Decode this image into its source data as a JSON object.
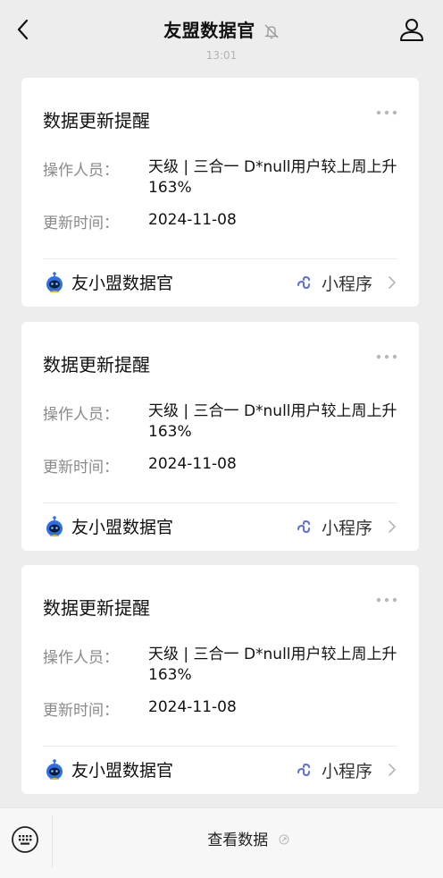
{
  "header": {
    "title": "友盟数据官",
    "timestamp_partial": "13:01"
  },
  "messages": [
    {
      "title": "数据更新提醒",
      "operator_label": "操作人员：",
      "operator_value": "天级 | 三合一 D*null用户较上周上升163%",
      "time_label": "更新时间：",
      "time_value": "2024-11-08",
      "source_name": "友小盟数据官",
      "mini_program_label": "小程序"
    },
    {
      "title": "数据更新提醒",
      "operator_label": "操作人员：",
      "operator_value": "天级 | 三合一 D*null用户较上周上升163%",
      "time_label": "更新时间：",
      "time_value": "2024-11-08",
      "source_name": "友小盟数据官",
      "mini_program_label": "小程序"
    },
    {
      "title": "数据更新提醒",
      "operator_label": "操作人员：",
      "operator_value": "天级 | 三合一 D*null用户较上周上升163%",
      "time_label": "更新时间：",
      "time_value": "2024-11-08",
      "source_name": "友小盟数据官",
      "mini_program_label": "小程序"
    }
  ],
  "bottom_bar": {
    "menu_label": "查看数据"
  },
  "icons": {
    "back": "chevron-left-icon",
    "mute": "bell-off-icon",
    "profile": "user-icon",
    "more": "more-dots-icon",
    "bot": "bot-avatar-icon",
    "mini_program": "mini-program-link-icon",
    "chevron": "chevron-right-icon",
    "keyboard": "keyboard-icon",
    "menu_link": "link-icon"
  },
  "colors": {
    "background": "#ededed",
    "card": "#ffffff",
    "label_gray": "#8a8a8a",
    "mini_program_blue": "#5b6ee1",
    "bot_blue": "#2f6fe4"
  }
}
